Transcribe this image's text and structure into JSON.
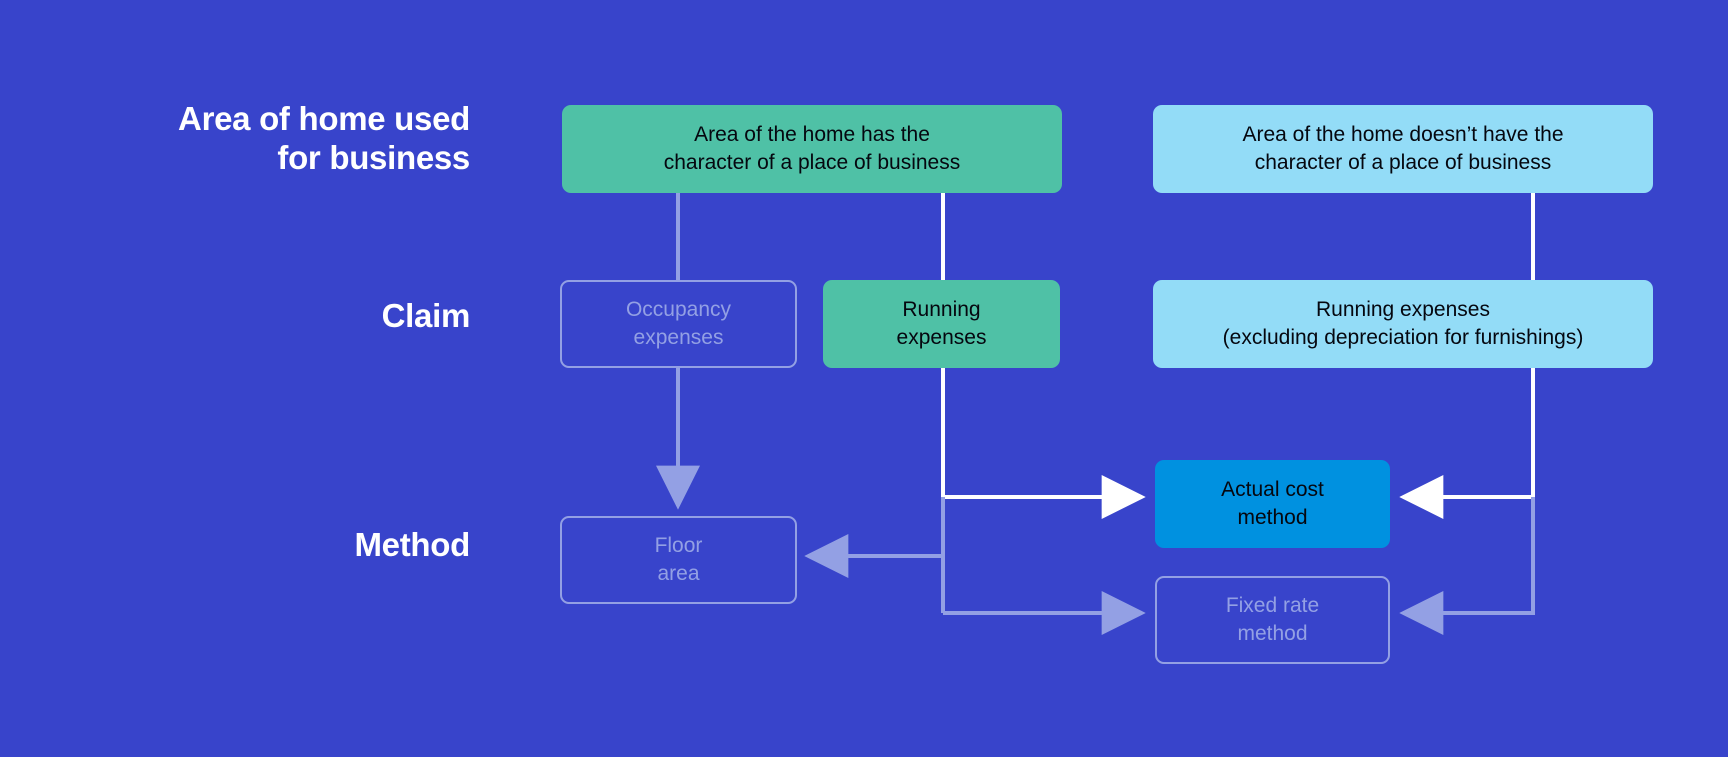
{
  "background_color": "#3844cb",
  "palette": {
    "green": "#4fc1a6",
    "sky_blue": "#93dcf7",
    "bright_blue": "#0091e0",
    "muted": "#93a0e4",
    "white": "#ffffff"
  },
  "rows": [
    {
      "id": "area",
      "label": "Area of home used\nfor business"
    },
    {
      "id": "claim",
      "label": "Claim"
    },
    {
      "id": "method",
      "label": "Method"
    }
  ],
  "nodes": {
    "character_yes": {
      "label": "Area of the home has the\ncharacter of a place of business",
      "style": "green",
      "state": "active"
    },
    "character_no": {
      "label": "Area of the home doesn’t have the\ncharacter of a place of business",
      "style": "sky",
      "state": "active"
    },
    "occupancy_expenses": {
      "label": "Occupancy\nexpenses",
      "style": "ghost",
      "state": "muted"
    },
    "running_expenses": {
      "label": "Running\nexpenses",
      "style": "green",
      "state": "active"
    },
    "running_expenses_excluding": {
      "label": "Running expenses\n(excluding depreciation for furnishings)",
      "style": "sky",
      "state": "active"
    },
    "actual_cost_method": {
      "label": "Actual cost\nmethod",
      "style": "bright",
      "state": "active"
    },
    "floor_area": {
      "label": "Floor\narea",
      "style": "ghost",
      "state": "muted"
    },
    "fixed_rate_method": {
      "label": "Fixed rate\nmethod",
      "style": "ghost",
      "state": "muted"
    }
  },
  "connectors": [
    {
      "from": "character_yes",
      "to": "occupancy_expenses",
      "style": "muted",
      "arrow": false
    },
    {
      "from": "occupancy_expenses",
      "to": "floor_area",
      "style": "muted",
      "arrow": true
    },
    {
      "from": "character_yes",
      "to": "running_expenses",
      "style": "white",
      "arrow": false
    },
    {
      "from": "running_expenses",
      "to": "actual_cost_method",
      "style": "white",
      "arrow": true
    },
    {
      "from": "running_expenses",
      "to": "floor_area",
      "style": "muted",
      "arrow": true
    },
    {
      "from": "running_expenses",
      "to": "fixed_rate_method",
      "style": "muted",
      "arrow": true
    },
    {
      "from": "character_no",
      "to": "running_expenses_excluding",
      "style": "white",
      "arrow": false
    },
    {
      "from": "running_expenses_excluding",
      "to": "actual_cost_method",
      "style": "white",
      "arrow": true
    },
    {
      "from": "running_expenses_excluding",
      "to": "fixed_rate_method",
      "style": "muted",
      "arrow": true
    }
  ]
}
